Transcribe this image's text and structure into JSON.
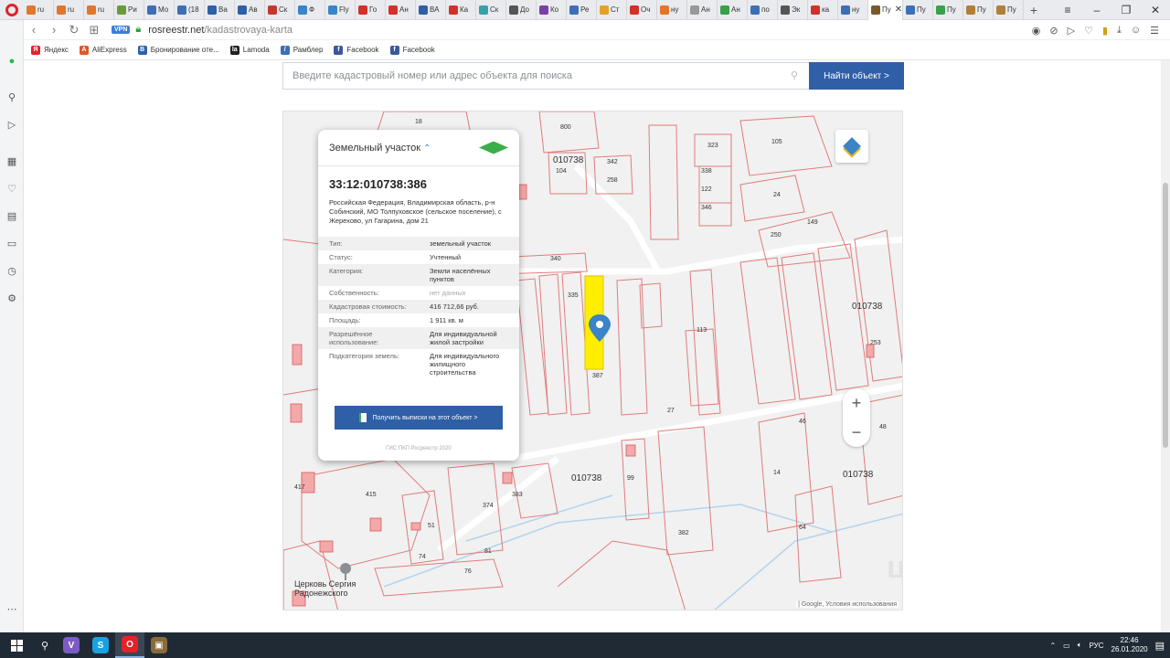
{
  "browser": {
    "tabs": [
      {
        "label": "ru",
        "color": "#e0772b"
      },
      {
        "label": "ru",
        "color": "#e0772b"
      },
      {
        "label": "ru",
        "color": "#e0772b"
      },
      {
        "label": "Ри",
        "color": "#6a9a3a"
      },
      {
        "label": "Мо",
        "color": "#3d6fb4"
      },
      {
        "label": "(18",
        "color": "#3d6fb4"
      },
      {
        "label": "Ва",
        "color": "#2f5fa7"
      },
      {
        "label": "Ав",
        "color": "#2f5fa7"
      },
      {
        "label": "Ск",
        "color": "#c2392f"
      },
      {
        "label": "Ф",
        "color": "#3a84c7"
      },
      {
        "label": "Fly",
        "color": "#3a84c7"
      },
      {
        "label": "Го",
        "color": "#d2302a"
      },
      {
        "label": "Ан",
        "color": "#d2302a"
      },
      {
        "label": "ВА",
        "color": "#2f5fa7"
      },
      {
        "label": "Ка",
        "color": "#d2302a"
      },
      {
        "label": "Ск",
        "color": "#3aa0a8"
      },
      {
        "label": "До",
        "color": "#555555"
      },
      {
        "label": "Ко",
        "color": "#7b3fa8"
      },
      {
        "label": "Ре",
        "color": "#3d6fb4"
      },
      {
        "label": "Ст",
        "color": "#e3a22a"
      },
      {
        "label": "Оч",
        "color": "#d2302a"
      },
      {
        "label": "ну",
        "color": "#e0772b"
      },
      {
        "label": "Ан",
        "color": "#999999"
      },
      {
        "label": "Ан",
        "color": "#3aa04a"
      },
      {
        "label": "по",
        "color": "#3d6fb4"
      },
      {
        "label": "Эк",
        "color": "#555555"
      },
      {
        "label": "ка",
        "color": "#d2302a"
      },
      {
        "label": "ну",
        "color": "#3d6fb4"
      },
      {
        "label": "Пу",
        "color": "#7a5a2a",
        "active": true
      },
      {
        "label": "Пу",
        "color": "#3d6fb4"
      },
      {
        "label": "Пу",
        "color": "#3aa04a"
      },
      {
        "label": "Пу",
        "color": "#b0803a"
      },
      {
        "label": "Пу",
        "color": "#b0803a"
      }
    ],
    "address": {
      "vpn": "VPN",
      "domain": "rosreestr.net",
      "path": "/kadastrovaya-karta"
    },
    "bookmarks": [
      {
        "label": "Яндекс",
        "icon": "Я",
        "color": "#e3222a"
      },
      {
        "label": "AliExpress",
        "icon": "A",
        "color": "#e0572b"
      },
      {
        "label": "Бронирование оте...",
        "icon": "B",
        "color": "#2f5fa7"
      },
      {
        "label": "Lamoda",
        "icon": "la",
        "color": "#222222"
      },
      {
        "label": "Рамблер",
        "icon": "/",
        "color": "#3d6fb4"
      },
      {
        "label": "Facebook",
        "icon": "f",
        "color": "#3b5998"
      },
      {
        "label": "Facebook",
        "icon": "f",
        "color": "#3b5998"
      }
    ]
  },
  "search": {
    "placeholder": "Введите кадастровый номер или адрес объекта для поиска",
    "button_label": "Найти объект >"
  },
  "card": {
    "title": "Земельный участок",
    "cadastral_number": "33:12:010738:386",
    "address": "Российская Федерация, Владимирская область, р-н Собинский, МО Толпуховское (сельское поселение), с Жерехово, ул Гагарина, дом 21",
    "properties": [
      {
        "key": "Тип:",
        "value": "земельный участок"
      },
      {
        "key": "Статус:",
        "value": "Учтенный"
      },
      {
        "key": "Категория:",
        "value": "Земли населённых пунктов"
      },
      {
        "key": "Собственность:",
        "value": "нет данных",
        "muted": true
      },
      {
        "key": "Кадастровая стоимость:",
        "value": "416 712,66 руб."
      },
      {
        "key": "Площадь:",
        "value": "1 911 кв. м"
      },
      {
        "key": "Разрешённое использование:",
        "value": "Для индивидуальной жилой застройки"
      },
      {
        "key": "Подкатегория земель:",
        "value": "Для индивидуального жилищного строительства"
      }
    ],
    "action_label": "Получить выписки на этот объект >",
    "footer": "ГИС ПКП Росреестр 2020"
  },
  "map": {
    "church": "Церковь Сергия Радонежского",
    "watermark": "циан",
    "attribution": "| Google, Условия использования",
    "zoom_in": "+",
    "zoom_out": "−",
    "labels": {
      "l18": "18",
      "l800": "800",
      "l010738a": "010738",
      "l104": "104",
      "l342": "342",
      "l258": "258",
      "l323": "323",
      "l105": "105",
      "l338": "338",
      "l122": "122",
      "l346": "346",
      "l24": "24",
      "l250": "250",
      "l149": "149",
      "l340": "340",
      "l335": "335",
      "l010738b": "010738",
      "l253": "253",
      "l113": "113",
      "l387": "387",
      "l27": "27",
      "l010738c": "010738",
      "l010738d": "010738",
      "l374": "374",
      "l383": "383",
      "l415": "415",
      "l417": "417",
      "l51": "51",
      "l74": "74",
      "l76": "76",
      "l81": "81",
      "l99": "99",
      "l14": "14",
      "l64": "64",
      "l382": "382",
      "l46": "46",
      "l48": "48"
    }
  },
  "taskbar": {
    "lang": "РУС",
    "time": "22:46",
    "date": "26.01.2020",
    "apps": [
      {
        "icon": "V",
        "color": "#7b5cc2"
      },
      {
        "icon": "S",
        "color": "#1aa1e0"
      },
      {
        "icon": "O",
        "color": "#e3222a",
        "active": true
      },
      {
        "icon": "▣",
        "color": "#8a6a3a"
      }
    ]
  },
  "colors": {
    "accent": "#2f5fa7",
    "parcel_line": "#e07c7c",
    "selected_parcel": "#ffee00"
  }
}
